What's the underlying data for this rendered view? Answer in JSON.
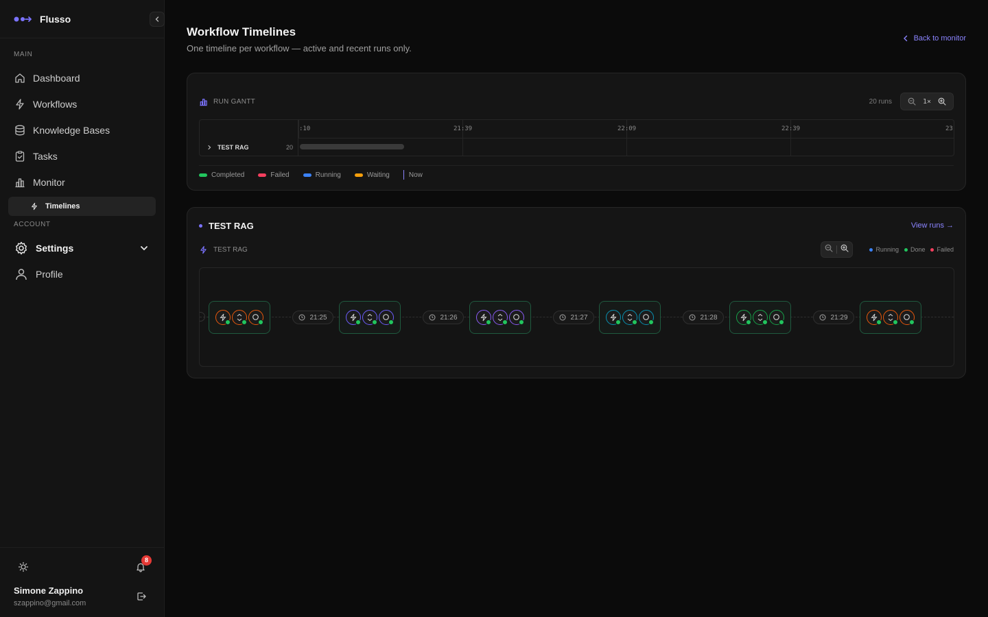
{
  "app": {
    "name": "Flusso"
  },
  "sidebar": {
    "main_label": "MAIN",
    "items": [
      {
        "label": "Dashboard",
        "icon": "home-icon"
      },
      {
        "label": "Workflows",
        "icon": "bolt-icon"
      },
      {
        "label": "Knowledge Bases",
        "icon": "database-icon"
      },
      {
        "label": "Tasks",
        "icon": "clipboard-icon"
      },
      {
        "label": "Monitor",
        "icon": "bar-chart-icon"
      }
    ],
    "sub_item": {
      "label": "Timelines",
      "icon": "bolt-icon"
    },
    "account_label": "ACCOUNT",
    "settings_label": "Settings",
    "profile_label": "Profile",
    "notifications_count": "8",
    "user": {
      "name": "Simone Zappino",
      "email": "szappino@gmail.com"
    }
  },
  "header": {
    "title": "Workflow Timelines",
    "subtitle": "One timeline per workflow — active and recent runs only.",
    "back_link": "Back to monitor"
  },
  "gantt": {
    "title": "RUN GANTT",
    "runs_count": "20 runs",
    "zoom_level": "1×",
    "ticks": [
      ":10",
      "21:39",
      "22:09",
      "22:39",
      "23:"
    ],
    "rows": [
      {
        "name": "TEST RAG",
        "count": "20"
      }
    ],
    "legend": [
      "Completed",
      "Failed",
      "Running",
      "Waiting",
      "Now"
    ],
    "colors": {
      "completed": "#22c55e",
      "failed": "#f43f5e",
      "running": "#3b82f6",
      "waiting": "#f59e0b",
      "now": "#8b84ff"
    }
  },
  "workflow": {
    "title": "TEST RAG",
    "view_runs": "View runs →",
    "subtitle": "TEST RAG",
    "legend": [
      "Running",
      "Done",
      "Failed"
    ],
    "times": [
      "21:25",
      "21:26",
      "21:27",
      "21:28",
      "21:29"
    ]
  }
}
